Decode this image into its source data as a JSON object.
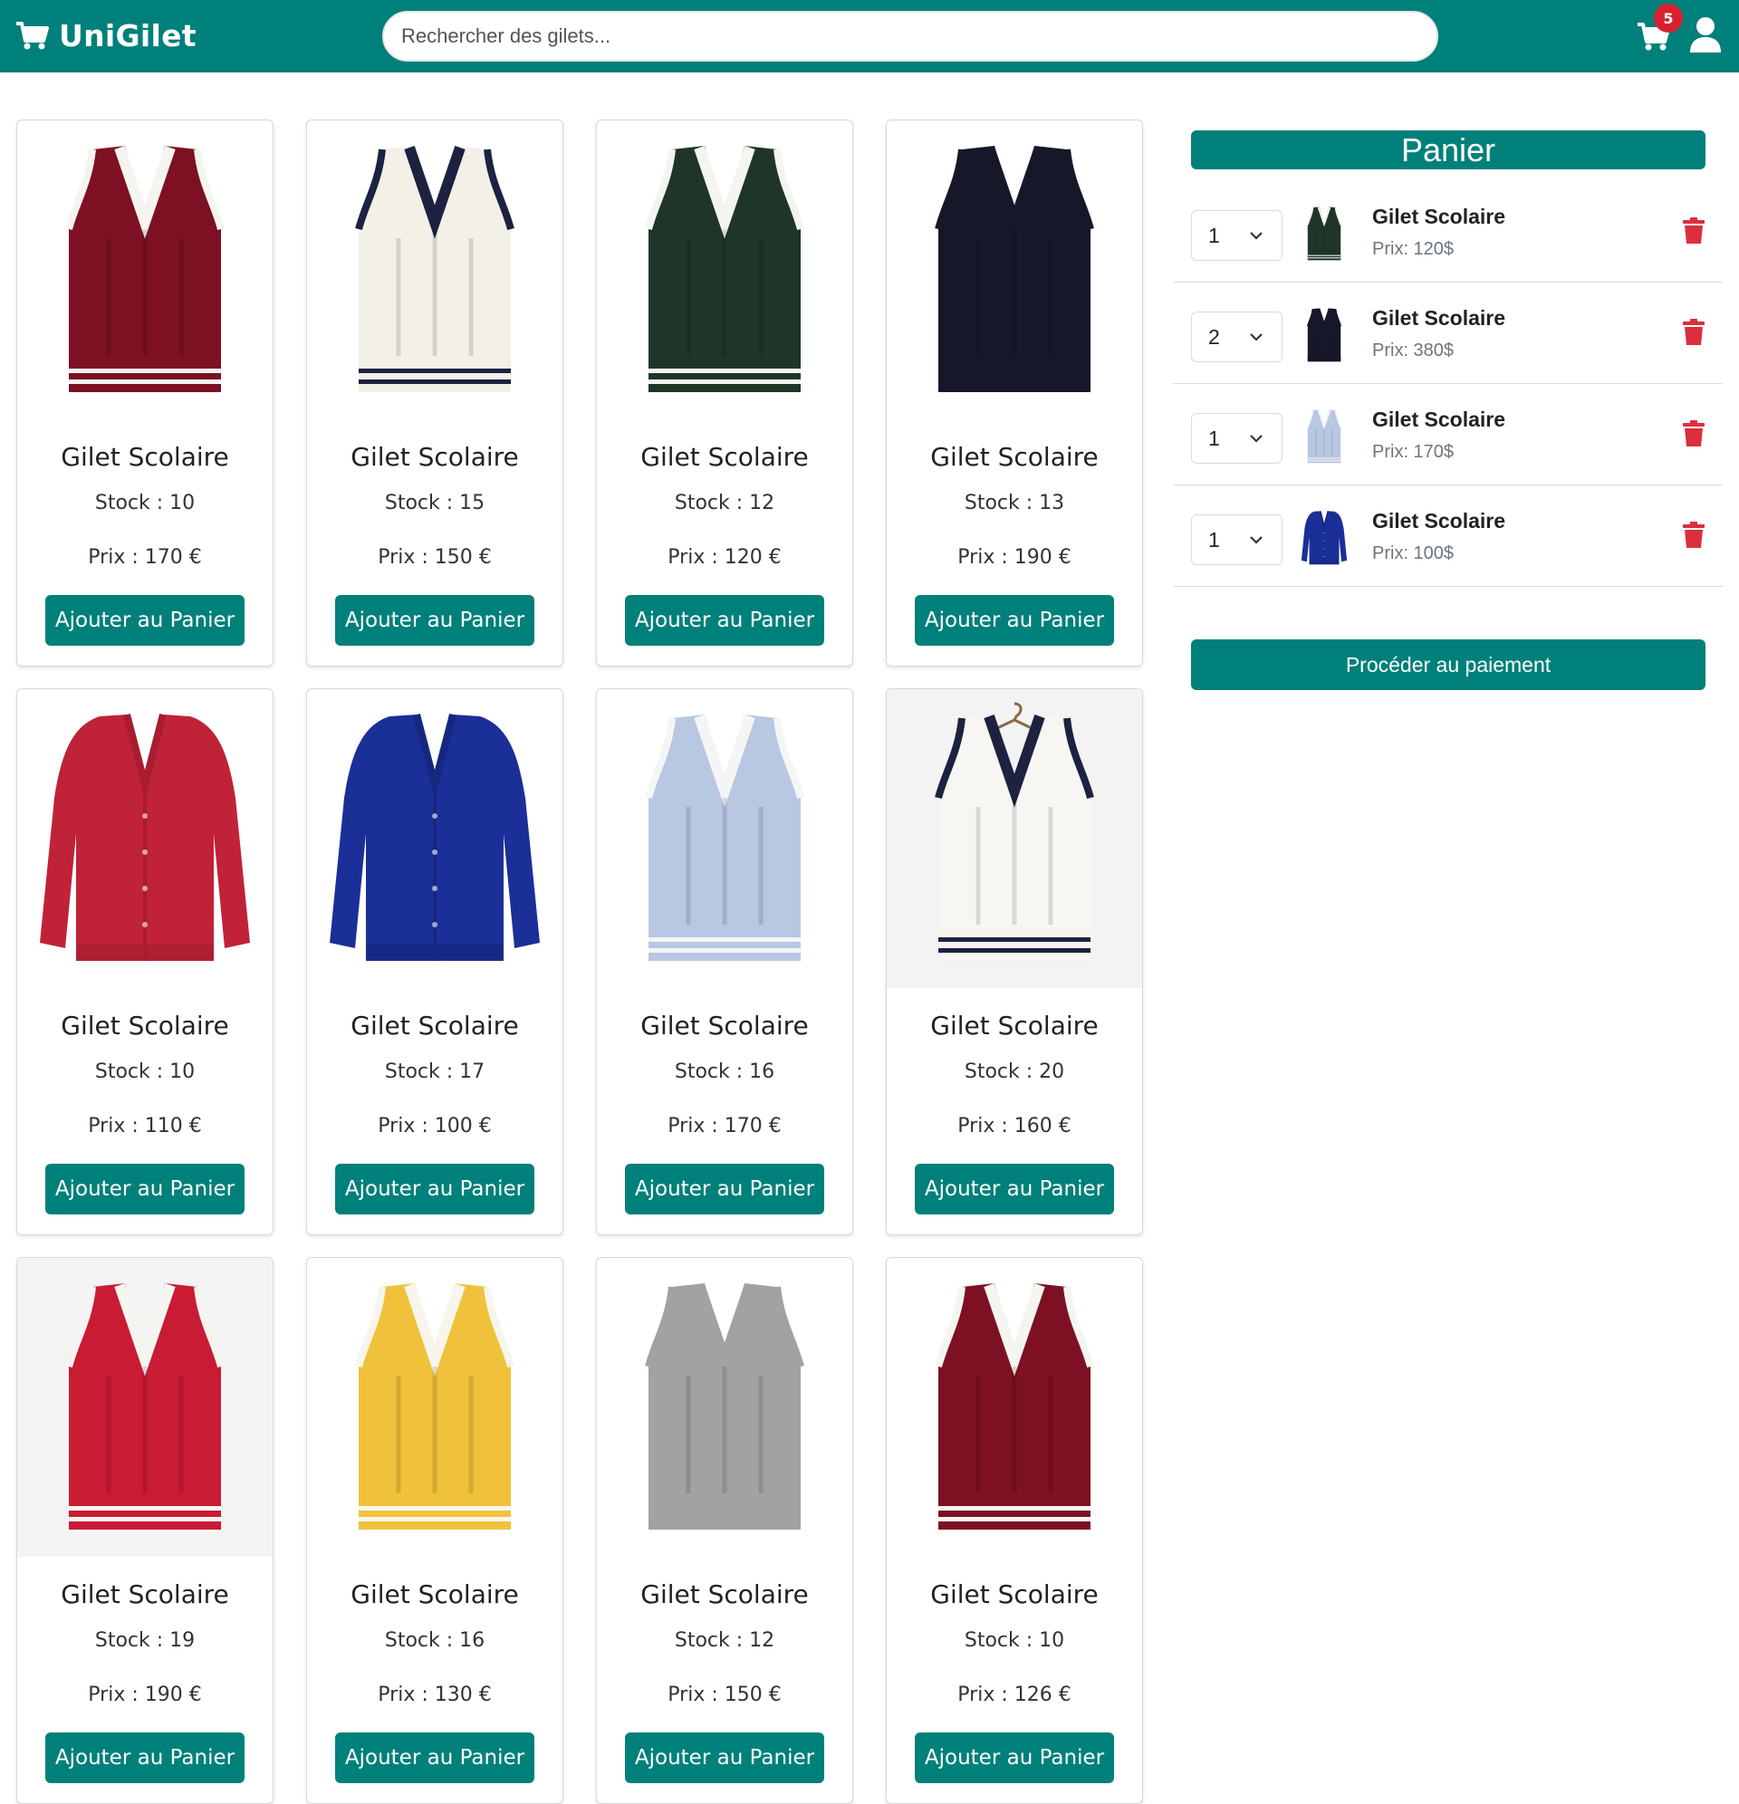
{
  "header": {
    "brand": "UniGilet",
    "search_placeholder": "Rechercher des gilets...",
    "cart_count": "5",
    "brand_color": "#00807a"
  },
  "products": [
    {
      "name": "Gilet Scolaire",
      "stock": "Stock : 10",
      "price": "Prix : 170 €",
      "button": "Ajouter au Panier",
      "image": "vest-burgundy-white-trim"
    },
    {
      "name": "Gilet Scolaire",
      "stock": "Stock : 15",
      "price": "Prix : 150 €",
      "button": "Ajouter au Panier",
      "image": "vest-cream-navy-trim"
    },
    {
      "name": "Gilet Scolaire",
      "stock": "Stock : 12",
      "price": "Prix : 120 €",
      "button": "Ajouter au Panier",
      "image": "vest-dark-green-white-trim"
    },
    {
      "name": "Gilet Scolaire",
      "stock": "Stock : 13",
      "price": "Prix : 190 €",
      "button": "Ajouter au Panier",
      "image": "vest-navy"
    },
    {
      "name": "Gilet Scolaire",
      "stock": "Stock : 10",
      "price": "Prix : 110 €",
      "button": "Ajouter au Panier",
      "image": "cardigan-red"
    },
    {
      "name": "Gilet Scolaire",
      "stock": "Stock : 17",
      "price": "Prix : 100 €",
      "button": "Ajouter au Panier",
      "image": "cardigan-royal-blue"
    },
    {
      "name": "Gilet Scolaire",
      "stock": "Stock : 16",
      "price": "Prix : 170 €",
      "button": "Ajouter au Panier",
      "image": "vest-light-blue"
    },
    {
      "name": "Gilet Scolaire",
      "stock": "Stock : 20",
      "price": "Prix : 160 €",
      "button": "Ajouter au Panier",
      "image": "vest-white-navy-hanger"
    },
    {
      "name": "Gilet Scolaire",
      "stock": "Stock : 19",
      "price": "Prix : 190 €",
      "button": "Ajouter au Panier",
      "image": "vest-red-white-trim"
    },
    {
      "name": "Gilet Scolaire",
      "stock": "Stock : 16",
      "price": "Prix : 130 €",
      "button": "Ajouter au Panier",
      "image": "vest-yellow-white-trim"
    },
    {
      "name": "Gilet Scolaire",
      "stock": "Stock : 12",
      "price": "Prix : 150 €",
      "button": "Ajouter au Panier",
      "image": "vest-grey-cable"
    },
    {
      "name": "Gilet Scolaire",
      "stock": "Stock : 10",
      "price": "Prix : 126 €",
      "button": "Ajouter au Panier",
      "image": "vest-burgundy-white-trim"
    }
  ],
  "cart": {
    "title": "Panier",
    "items": [
      {
        "qty": "1",
        "name": "Gilet Scolaire",
        "price": "Prix: 120$",
        "image": "vest-dark-green"
      },
      {
        "qty": "2",
        "name": "Gilet Scolaire",
        "price": "Prix: 380$",
        "image": "vest-navy"
      },
      {
        "qty": "1",
        "name": "Gilet Scolaire",
        "price": "Prix: 170$",
        "image": "vest-light-blue"
      },
      {
        "qty": "1",
        "name": "Gilet Scolaire",
        "price": "Prix: 100$",
        "image": "cardigan-royal-blue"
      }
    ],
    "checkout_label": "Procéder au paiement"
  }
}
